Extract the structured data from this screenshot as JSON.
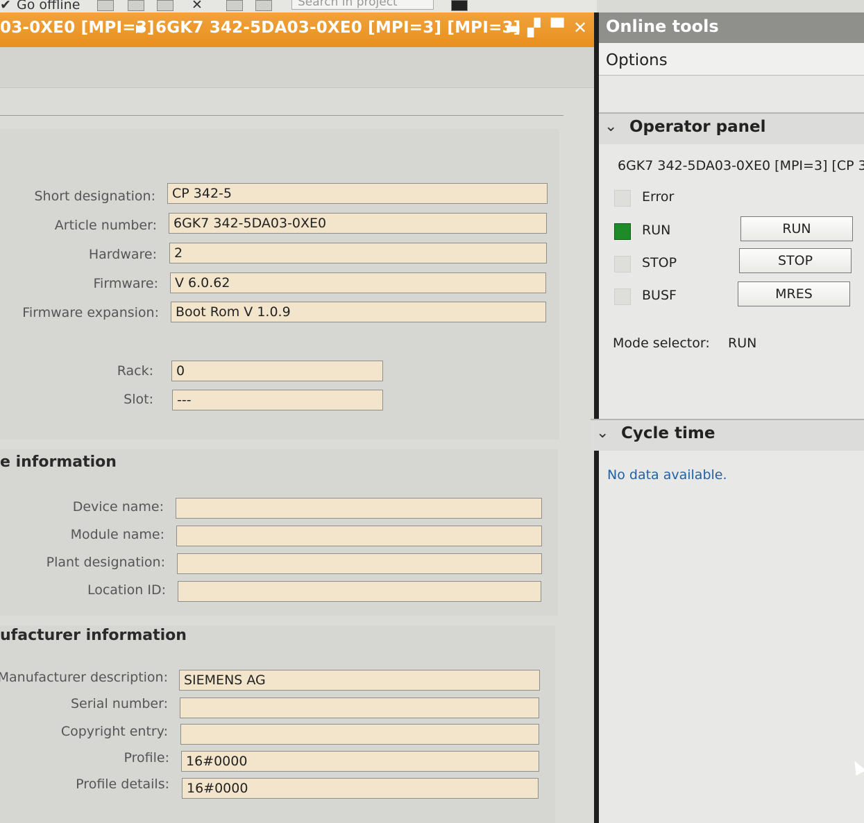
{
  "toolbar": {
    "go_offline": "Go offline",
    "search_placeholder": "Search in project"
  },
  "title_bar": {
    "breadcrumb_device": "03-0XE0 [MPI=3]",
    "breadcrumb_module": "6GK7 342-5DA03-0XE0 [MPI=3] [MPI=3]"
  },
  "general": {
    "short_designation_label": "Short designation:",
    "short_designation": "CP 342-5",
    "article_number_label": "Article number:",
    "article_number": "6GK7 342-5DA03-0XE0",
    "hardware_label": "Hardware:",
    "hardware": "2",
    "firmware_label": "Firmware:",
    "firmware": "V 6.0.62",
    "firmware_expansion_label": "Firmware expansion:",
    "firmware_expansion": "Boot Rom V 1.0.9",
    "rack_label": "Rack:",
    "rack": "0",
    "slot_label": "Slot:",
    "slot": "---"
  },
  "module_info": {
    "heading": "e information",
    "device_name_label": "Device name:",
    "device_name": "",
    "module_name_label": "Module name:",
    "module_name": "",
    "plant_designation_label": "Plant designation:",
    "plant_designation": "",
    "location_id_label": "Location ID:",
    "location_id": ""
  },
  "manufacturer_info": {
    "heading": "ufacturer information",
    "manufacturer_description_label": "Manufacturer description:",
    "manufacturer_description": "SIEMENS AG",
    "serial_number_label": "Serial number:",
    "serial_number": "",
    "copyright_entry_label": "Copyright entry:",
    "copyright_entry": "",
    "profile_label": "Profile:",
    "profile": "16#0000",
    "profile_details_label": "Profile details:",
    "profile_details": "16#0000"
  },
  "online_tools": {
    "title": "Online tools",
    "options": "Options",
    "operator_panel": {
      "heading": "Operator panel",
      "device": "6GK7 342-5DA03-0XE0 [MPI=3] [CP 3",
      "leds": {
        "error": "Error",
        "run": "RUN",
        "stop": "STOP",
        "busf": "BUSF"
      },
      "buttons": {
        "run": "RUN",
        "stop": "STOP",
        "mres": "MRES"
      },
      "mode_selector_label": "Mode selector:",
      "mode_selector_value": "RUN"
    },
    "cycle_time": {
      "heading": "Cycle time",
      "message": "No data available."
    }
  },
  "colors": {
    "title_orange": "#e8901e",
    "field_bg": "#f3e5cc",
    "run_led": "#1e8a28",
    "nodata_text": "#1f62a8"
  }
}
